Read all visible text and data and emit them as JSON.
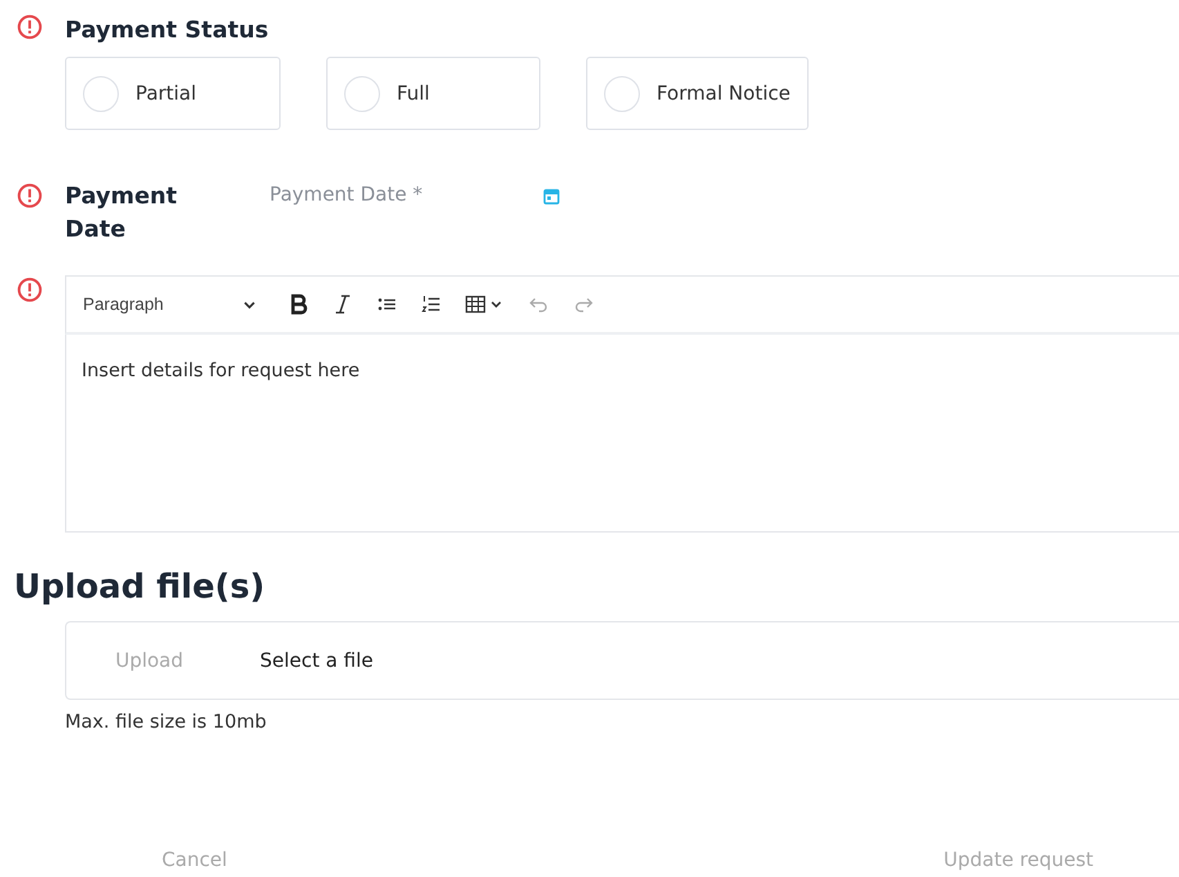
{
  "payment_status": {
    "label": "Payment Status",
    "error": true,
    "options": [
      {
        "label": "Partial",
        "selected": false
      },
      {
        "label": "Full",
        "selected": false
      },
      {
        "label": "Formal Notice",
        "selected": false
      }
    ]
  },
  "payment_date": {
    "label": "Payment Date",
    "error": true,
    "placeholder": "Payment Date *"
  },
  "details": {
    "error": true,
    "toolbar": {
      "block_format": "Paragraph"
    },
    "placeholder": "Insert details for request here"
  },
  "upload": {
    "heading": "Upload file(s)",
    "button": "Upload",
    "file_label": "Select a file",
    "hint": "Max. file size is 10mb"
  },
  "actions": {
    "cancel": "Cancel",
    "submit": "Update request"
  }
}
